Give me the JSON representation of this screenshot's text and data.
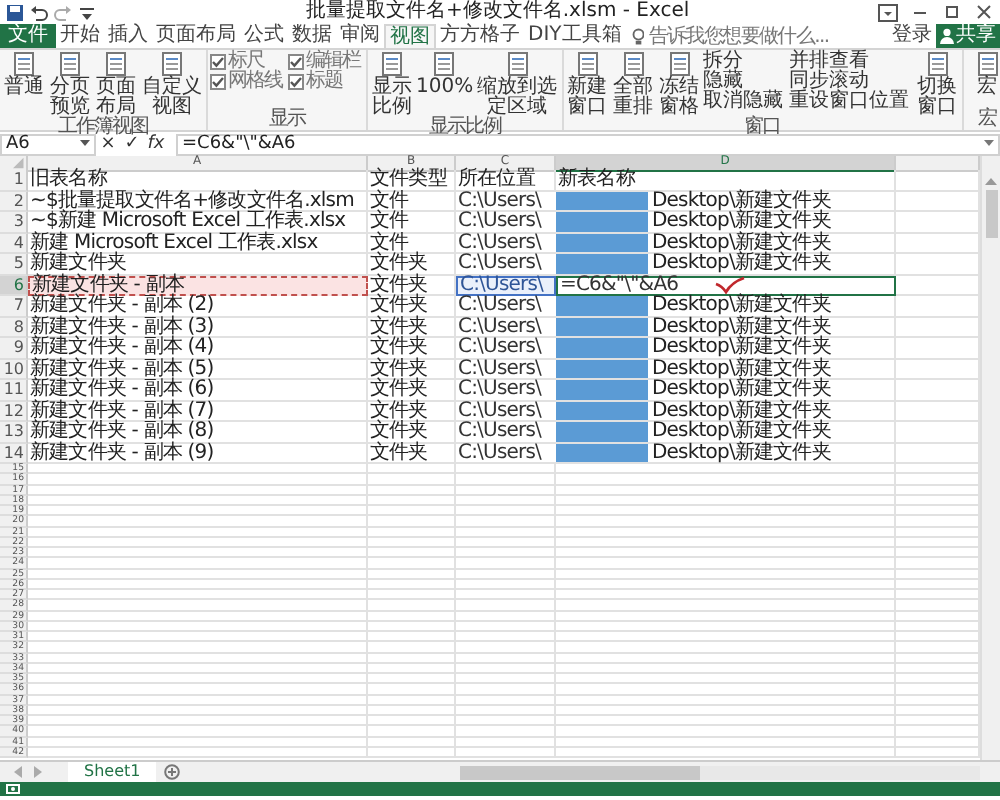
{
  "title_bar": {
    "title": "批量提取文件名+修改文件名.xlsm - Excel"
  },
  "tabs": [
    {
      "kind": "file",
      "label": "文件",
      "selected": false
    },
    {
      "kind": "tab",
      "label": "开始",
      "selected": false
    },
    {
      "kind": "tab",
      "label": "插入",
      "selected": false
    },
    {
      "kind": "tab",
      "label": "页面布局",
      "selected": false
    },
    {
      "kind": "tab",
      "label": "公式",
      "selected": false
    },
    {
      "kind": "tab",
      "label": "数据",
      "selected": false
    },
    {
      "kind": "tab",
      "label": "审阅",
      "selected": false
    },
    {
      "kind": "tab",
      "label": "视图",
      "selected": true
    },
    {
      "kind": "tab",
      "label": "方方格子",
      "selected": false
    },
    {
      "kind": "tab",
      "label": "DIY工具箱",
      "selected": false
    }
  ],
  "search": {
    "placeholder": "告诉我您想要做什么..."
  },
  "account": {
    "sign_in": "登录",
    "share": "共享"
  },
  "ribbon": {
    "groups": [
      {
        "label": "工作簿视图",
        "items": [
          {
            "kind": "large",
            "label": "普通"
          },
          {
            "kind": "large",
            "label": "分页预览"
          },
          {
            "kind": "large",
            "label": "页面布局"
          },
          {
            "kind": "large",
            "label": "自定义视图"
          }
        ]
      },
      {
        "label": "显示",
        "items": [
          {
            "kind": "check",
            "label": "标尺",
            "checked": true
          },
          {
            "kind": "check",
            "label": "网格线",
            "checked": true
          },
          {
            "kind": "check",
            "label": "编辑栏",
            "checked": true
          },
          {
            "kind": "check",
            "label": "标题",
            "checked": true
          }
        ]
      },
      {
        "label": "显示比例",
        "items": [
          {
            "kind": "large",
            "label": "显示比例"
          },
          {
            "kind": "large",
            "label": "100%"
          },
          {
            "kind": "large",
            "label": "缩放到选定区域"
          }
        ]
      },
      {
        "label": "窗口",
        "items": [
          {
            "kind": "large",
            "label": "新建窗口"
          },
          {
            "kind": "large",
            "label": "全部重排"
          },
          {
            "kind": "large",
            "label": "冻结窗格"
          },
          {
            "kind": "small",
            "label": "拆分"
          },
          {
            "kind": "small",
            "label": "隐藏"
          },
          {
            "kind": "small",
            "label": "取消隐藏"
          },
          {
            "kind": "small",
            "label": "并排查看"
          },
          {
            "kind": "small",
            "label": "同步滚动"
          },
          {
            "kind": "small",
            "label": "重设窗口位置"
          },
          {
            "kind": "large",
            "label": "切换窗口"
          }
        ]
      },
      {
        "label": "宏",
        "items": [
          {
            "kind": "large",
            "label": "宏"
          }
        ]
      }
    ]
  },
  "formula_bar": {
    "name_box": "A6",
    "cancel": "×",
    "enter": "✓",
    "function": "fx",
    "formula": "=C6&\"\\\"&A6"
  },
  "columns": [
    {
      "label": "A",
      "selected": false
    },
    {
      "label": "B",
      "selected": false
    },
    {
      "label": "C",
      "selected": false
    },
    {
      "label": "D",
      "selected": true
    }
  ],
  "rows": [
    {
      "number": "1",
      "kind": "header",
      "selected": false,
      "a": "旧表名称",
      "b": "文件类型",
      "c": "所在位置",
      "d": "新表名称"
    },
    {
      "number": "2",
      "kind": "data",
      "selected": false,
      "a": "~$批量提取文件名+修改文件名.xlsm",
      "b": "文件",
      "c": "C:\\Users\\",
      "redacted": true,
      "c_end": "Desktop\\新建文件夹"
    },
    {
      "number": "3",
      "kind": "data",
      "selected": false,
      "a": "~$新建 Microsoft Excel 工作表.xlsx",
      "b": "文件",
      "c": "C:\\Users\\",
      "redacted": true,
      "c_end": "Desktop\\新建文件夹"
    },
    {
      "number": "4",
      "kind": "data",
      "selected": false,
      "a": "新建 Microsoft Excel 工作表.xlsx",
      "b": "文件",
      "c": "C:\\Users\\",
      "redacted": true,
      "c_end": "Desktop\\新建文件夹"
    },
    {
      "number": "5",
      "kind": "data",
      "selected": false,
      "a": "新建文件夹",
      "b": "文件夹",
      "c": "C:\\Users\\",
      "redacted": true,
      "c_end": "Desktop\\新建文件夹"
    },
    {
      "number": "6",
      "kind": "editing",
      "selected": true,
      "a": "新建文件夹 - 副本",
      "b": "文件夹",
      "c": "C:\\Users\\",
      "d": "=C6&\"\\\"&A6"
    },
    {
      "number": "7",
      "kind": "data",
      "selected": false,
      "a": "新建文件夹 - 副本 (2)",
      "b": "文件夹",
      "c": "C:\\Users\\",
      "redacted": true,
      "c_end": "Desktop\\新建文件夹"
    },
    {
      "number": "8",
      "kind": "data",
      "selected": false,
      "a": "新建文件夹 - 副本 (3)",
      "b": "文件夹",
      "c": "C:\\Users\\",
      "redacted": true,
      "c_end": "Desktop\\新建文件夹"
    },
    {
      "number": "9",
      "kind": "data",
      "selected": false,
      "a": "新建文件夹 - 副本 (4)",
      "b": "文件夹",
      "c": "C:\\Users\\",
      "redacted": true,
      "c_end": "Desktop\\新建文件夹"
    },
    {
      "number": "10",
      "kind": "data",
      "selected": false,
      "a": "新建文件夹 - 副本 (5)",
      "b": "文件夹",
      "c": "C:\\Users\\",
      "redacted": true,
      "c_end": "Desktop\\新建文件夹"
    },
    {
      "number": "11",
      "kind": "data",
      "selected": false,
      "a": "新建文件夹 - 副本 (6)",
      "b": "文件夹",
      "c": "C:\\Users\\",
      "redacted": true,
      "c_end": "Desktop\\新建文件夹"
    },
    {
      "number": "12",
      "kind": "data",
      "selected": false,
      "a": "新建文件夹 - 副本 (7)",
      "b": "文件夹",
      "c": "C:\\Users\\",
      "redacted": true,
      "c_end": "Desktop\\新建文件夹"
    },
    {
      "number": "13",
      "kind": "data",
      "selected": false,
      "a": "新建文件夹 - 副本 (8)",
      "b": "文件夹",
      "c": "C:\\Users\\",
      "redacted": true,
      "c_end": "Desktop\\新建文件夹"
    },
    {
      "number": "14",
      "kind": "data",
      "selected": false,
      "a": "新建文件夹 - 副本 (9)",
      "b": "文件夹",
      "c": "C:\\Users\\",
      "redacted": true,
      "c_end": "Desktop\\新建文件夹"
    },
    {
      "number": "15",
      "kind": "empty",
      "selected": false
    },
    {
      "number": "16",
      "kind": "empty",
      "selected": false
    },
    {
      "number": "17",
      "kind": "empty",
      "selected": false
    },
    {
      "number": "18",
      "kind": "empty",
      "selected": false
    },
    {
      "number": "19",
      "kind": "empty",
      "selected": false
    },
    {
      "number": "20",
      "kind": "empty",
      "selected": false
    },
    {
      "number": "21",
      "kind": "empty",
      "selected": false
    },
    {
      "number": "22",
      "kind": "empty",
      "selected": false
    },
    {
      "number": "23",
      "kind": "empty",
      "selected": false
    },
    {
      "number": "24",
      "kind": "empty",
      "selected": false
    },
    {
      "number": "25",
      "kind": "empty",
      "selected": false
    },
    {
      "number": "26",
      "kind": "empty",
      "selected": false
    },
    {
      "number": "27",
      "kind": "empty",
      "selected": false
    },
    {
      "number": "28",
      "kind": "empty",
      "selected": false
    },
    {
      "number": "29",
      "kind": "empty",
      "selected": false
    },
    {
      "number": "30",
      "kind": "empty",
      "selected": false
    },
    {
      "number": "31",
      "kind": "empty",
      "selected": false
    },
    {
      "number": "32",
      "kind": "empty",
      "selected": false
    },
    {
      "number": "33",
      "kind": "empty",
      "selected": false
    },
    {
      "number": "34",
      "kind": "empty",
      "selected": false
    },
    {
      "number": "35",
      "kind": "empty",
      "selected": false
    },
    {
      "number": "36",
      "kind": "empty",
      "selected": false
    },
    {
      "number": "37",
      "kind": "empty",
      "selected": false
    },
    {
      "number": "38",
      "kind": "empty",
      "selected": false
    },
    {
      "number": "39",
      "kind": "empty",
      "selected": false
    },
    {
      "number": "40",
      "kind": "empty",
      "selected": false
    },
    {
      "number": "41",
      "kind": "empty",
      "selected": false
    },
    {
      "number": "42",
      "kind": "empty",
      "selected": false
    }
  ],
  "sheets": [
    {
      "label": "Sheet1",
      "selected": true
    }
  ]
}
